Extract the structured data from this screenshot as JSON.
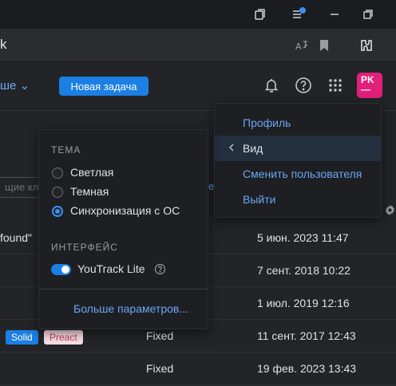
{
  "browser": {
    "address_text": "k"
  },
  "header": {
    "more_label": "ше ⌄",
    "new_task_label": "Новая задача",
    "avatar_initials": "PK",
    "avatar_sub": "—"
  },
  "background": {
    "search_placeholder": "щие кл",
    "link_fragment": "е",
    "rows": [
      {
        "left": "found\"",
        "state": "",
        "date": "5 июн. 2023 11:47"
      },
      {
        "left": "",
        "state": "",
        "date": "7 сент. 2018 10:22"
      },
      {
        "left": "",
        "state": "",
        "date": "1 июл. 2019 12:16"
      },
      {
        "left": "",
        "state": "Fixed",
        "date": "11 сент. 2017 12:43"
      },
      {
        "left": "",
        "state": "Fixed",
        "date": "19 фев. 2023 13:43"
      }
    ],
    "tags": {
      "solid": "Solid",
      "preact": "Preact"
    }
  },
  "account_menu": {
    "items": [
      {
        "label": "Профиль"
      },
      {
        "label": "Вид"
      },
      {
        "label": "Сменить пользователя"
      },
      {
        "label": "Выйти"
      }
    ]
  },
  "view_menu": {
    "theme_title": "ТЕМА",
    "themes": [
      {
        "label": "Светлая",
        "selected": false
      },
      {
        "label": "Темная",
        "selected": false
      },
      {
        "label": "Синхронизация с ОС",
        "selected": true
      }
    ],
    "interface_title": "ИНТЕРФЕЙС",
    "youtrack_lite_label": "YouTrack Lite",
    "youtrack_lite_enabled": true,
    "more_params_label": "Больше параметров..."
  },
  "colors": {
    "accent": "#1b7fe3",
    "link": "#6aa7f5",
    "avatar_bg": "#e21f79",
    "notification_dot": "#3b8ef0"
  }
}
